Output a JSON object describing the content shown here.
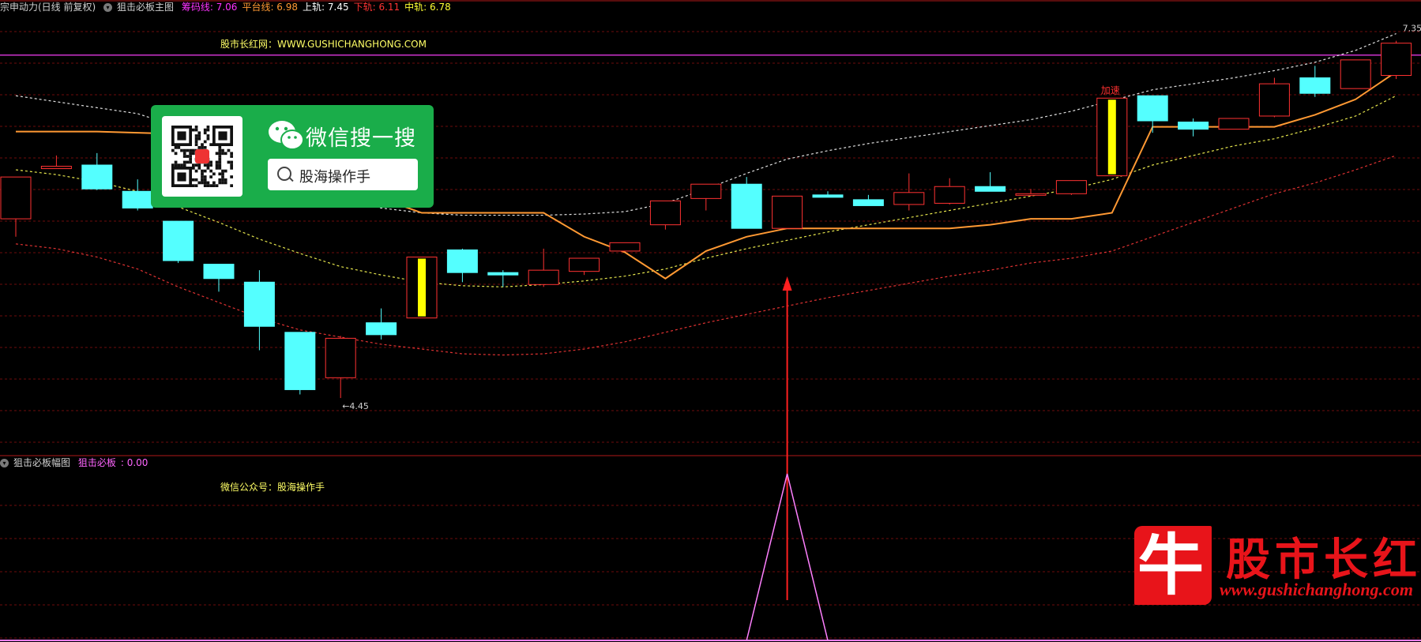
{
  "colors": {
    "background": "#000000",
    "grid": "#6e0d0d",
    "panel_border": "#b01818",
    "up": "#ff3232",
    "down": "#54ffff",
    "signal_bar": "#ffff00",
    "platform": "#ff9933",
    "upper_band": "#e0e0e0",
    "middle_band": "#e6e64d",
    "lower_band": "#e03232",
    "chip": "#ff00ff",
    "sub_line": "#ff80ff",
    "arrow": "#ff2020",
    "horizontal_line": "#cc33cc"
  },
  "header": {
    "stock_name": "宗申动力(日线 前复权)",
    "indicator_name": "狙击必板主图",
    "items": [
      {
        "label": "筹码线",
        "value": "7.06",
        "color": "#ff33ff"
      },
      {
        "label": "平台线",
        "value": "6.98",
        "color": "#ff9933"
      },
      {
        "label": "上轨",
        "value": "7.45",
        "color": "#ffffff"
      },
      {
        "label": "下轨",
        "value": "6.11",
        "color": "#ff3333"
      },
      {
        "label": "中轨",
        "value": "6.78",
        "color": "#ffff33"
      }
    ]
  },
  "watermark_top": "股市长红网：WWW.GUSHICHANGHONG.COM",
  "wechat_card": {
    "title": "微信搜一搜",
    "search_text": "股海操作手",
    "logo_icon": "wechat-icon",
    "qr_icon": "qr-code-icon"
  },
  "sub_header": {
    "indicator_name": "狙击必板幅图",
    "label": "狙击必板",
    "value": "0.00",
    "color": "#ff66ff"
  },
  "watermark_sub": "微信公众号：股海操作手",
  "brand": {
    "glyph": "牛",
    "name": "股市长红",
    "url": "www.gushichanghong.com"
  },
  "chart_data": {
    "type": "candlestick",
    "ylim": [
      4.1,
      7.55
    ],
    "high_label": "7.35",
    "low_label": "4.45",
    "candles": [
      {
        "o": 5.95,
        "h": 6.08,
        "c": 6.3,
        "l": 5.8
      },
      {
        "o": 6.37,
        "h": 6.48,
        "c": 6.39
      },
      {
        "o": 6.4,
        "h": 6.5,
        "c": 6.2,
        "l": 6.19
      },
      {
        "o": 6.18,
        "h": 6.28,
        "c": 6.04,
        "l": 6.02
      },
      {
        "o": 5.93,
        "h": 5.93,
        "c": 5.6,
        "l": 5.58
      },
      {
        "o": 5.57,
        "h": 5.57,
        "c": 5.45,
        "l": 5.34
      },
      {
        "o": 5.42,
        "h": 5.52,
        "c": 5.05,
        "l": 4.85
      },
      {
        "o": 5.0,
        "h": 5.0,
        "c": 4.52,
        "l": 4.48
      },
      {
        "o": 4.62,
        "h": 4.97,
        "c": 4.95,
        "l": 4.45
      },
      {
        "o": 5.08,
        "h": 5.2,
        "c": 4.98,
        "l": 4.94
      },
      {
        "o": 5.12,
        "h": 5.12,
        "c": 5.63,
        "l": 5.12,
        "signal": true
      },
      {
        "o": 5.69,
        "h": 5.7,
        "c": 5.5,
        "l": 5.42
      },
      {
        "o": 5.5,
        "h": 5.52,
        "c": 5.48,
        "l": 5.38
      },
      {
        "o": 5.4,
        "h": 5.7,
        "c": 5.52,
        "l": 5.38
      },
      {
        "o": 5.51,
        "h": 5.62,
        "c": 5.62,
        "l": 5.48
      },
      {
        "o": 5.68,
        "h": 5.72,
        "c": 5.75
      },
      {
        "o": 5.9,
        "h": 6.1,
        "c": 6.1,
        "l": 5.86
      },
      {
        "o": 6.12,
        "h": 6.14,
        "c": 6.24,
        "l": 6.02
      },
      {
        "o": 6.24,
        "h": 6.3,
        "c": 5.87,
        "l": 5.87
      },
      {
        "o": 5.87,
        "h": 6.14,
        "c": 6.14,
        "l": 5.87
      },
      {
        "o": 6.15,
        "h": 6.18,
        "c": 6.13
      },
      {
        "o": 6.11,
        "h": 6.15,
        "c": 6.06,
        "l": 6.06
      },
      {
        "o": 6.07,
        "h": 6.33,
        "c": 6.17,
        "l": 6.02
      },
      {
        "o": 6.08,
        "h": 6.29,
        "c": 6.22,
        "l": 6.07
      },
      {
        "o": 6.22,
        "h": 6.34,
        "c": 6.18,
        "l": 6.18
      },
      {
        "o": 6.16,
        "h": 6.2,
        "c": 6.16,
        "l": 6.14
      },
      {
        "o": 6.16,
        "h": 6.25,
        "c": 6.27,
        "l": 6.15
      },
      {
        "o": 6.31,
        "h": 6.8,
        "c": 6.96,
        "l": 6.31,
        "signal": true,
        "label": "加速"
      },
      {
        "o": 6.98,
        "h": 6.98,
        "c": 6.77,
        "l": 6.67
      },
      {
        "o": 6.76,
        "h": 6.79,
        "c": 6.7,
        "l": 6.64
      },
      {
        "o": 6.7,
        "h": 6.7,
        "c": 6.79,
        "l": 6.7
      },
      {
        "o": 6.81,
        "h": 7.13,
        "c": 7.08,
        "l": 6.8
      },
      {
        "o": 7.13,
        "h": 7.23,
        "c": 7.0,
        "l": 6.97
      },
      {
        "o": 7.04,
        "h": 7.28,
        "c": 7.28
      },
      {
        "o": 7.15,
        "h": 7.44,
        "c": 7.42,
        "l": 7.12
      }
    ],
    "platform_line": [
      6.68,
      6.68,
      6.68,
      6.67,
      6.66,
      6.64,
      6.62,
      6.45,
      6.28,
      6.12,
      6.0,
      6.0,
      6.0,
      6.0,
      5.8,
      5.67,
      5.45,
      5.68,
      5.8,
      5.87,
      5.87,
      5.87,
      5.87,
      5.87,
      5.9,
      5.95,
      5.95,
      6.0,
      6.72,
      6.72,
      6.72,
      6.72,
      6.82,
      6.95,
      7.18
    ],
    "upper_band": [
      6.98,
      6.93,
      6.88,
      6.83,
      6.72,
      6.56,
      6.4,
      6.25,
      6.12,
      6.04,
      6.0,
      5.98,
      5.98,
      5.98,
      5.99,
      6.01,
      6.08,
      6.2,
      6.33,
      6.45,
      6.52,
      6.58,
      6.63,
      6.68,
      6.73,
      6.78,
      6.85,
      6.94,
      7.03,
      7.08,
      7.13,
      7.19,
      7.26,
      7.36,
      7.5
    ],
    "middle_band": [
      6.36,
      6.32,
      6.26,
      6.18,
      6.05,
      5.92,
      5.78,
      5.66,
      5.55,
      5.48,
      5.42,
      5.39,
      5.38,
      5.4,
      5.43,
      5.47,
      5.53,
      5.62,
      5.7,
      5.77,
      5.84,
      5.9,
      5.96,
      6.02,
      6.08,
      6.14,
      6.2,
      6.28,
      6.4,
      6.48,
      6.56,
      6.62,
      6.71,
      6.81,
      6.98
    ],
    "lower_band": [
      5.74,
      5.7,
      5.63,
      5.53,
      5.38,
      5.25,
      5.12,
      5.02,
      4.96,
      4.9,
      4.86,
      4.82,
      4.81,
      4.82,
      4.86,
      4.92,
      5.0,
      5.08,
      5.15,
      5.22,
      5.29,
      5.35,
      5.41,
      5.47,
      5.52,
      5.58,
      5.62,
      5.68,
      5.8,
      5.92,
      6.04,
      6.16,
      6.25,
      6.36,
      6.48
    ],
    "horizontal_level": 7.32,
    "arrow_at_index": 19,
    "sub_chart": {
      "type": "line",
      "series": [
        {
          "name": "狙击必板",
          "values": [
            0,
            0,
            0,
            0,
            0,
            0,
            0,
            0,
            0,
            0,
            0,
            0,
            0,
            0,
            0,
            0,
            0,
            0,
            0,
            1,
            0,
            0,
            0,
            0,
            0,
            0,
            0,
            0,
            0,
            0,
            0,
            0,
            0,
            0,
            0
          ]
        }
      ],
      "ylim": [
        0,
        1
      ]
    }
  }
}
